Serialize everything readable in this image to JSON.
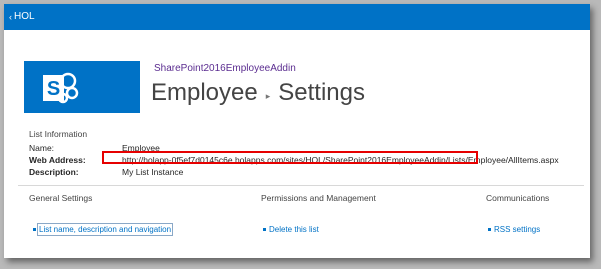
{
  "topbar": {
    "back_label": "HOL",
    "back_icon": "chevron-left-icon"
  },
  "site": {
    "link_label": "SharePoint2016EmployeeAddin"
  },
  "breadcrumb": {
    "list_name": "Employee",
    "separator": "▸",
    "current": "Settings"
  },
  "list_info": {
    "section_title": "List Information",
    "name_label": "Name:",
    "name_value": "Employee",
    "web_address_label": "Web Address:",
    "web_address_value": "http://holapp-0f5ef7d0145c6e.holapps.com/sites/HOL/SharePoint2016EmployeeAddin/Lists/Employee/AllItems.aspx",
    "description_label": "Description:",
    "description_value": "My List Instance"
  },
  "columns": {
    "general": {
      "heading": "General Settings",
      "link": "List name, description and navigation"
    },
    "permissions": {
      "heading": "Permissions and Management",
      "link": "Delete this list"
    },
    "communications": {
      "heading": "Communications",
      "link": "RSS settings"
    }
  },
  "colors": {
    "brand": "#0072c6",
    "site_link": "#5b2d90",
    "highlight": "#e60000"
  }
}
